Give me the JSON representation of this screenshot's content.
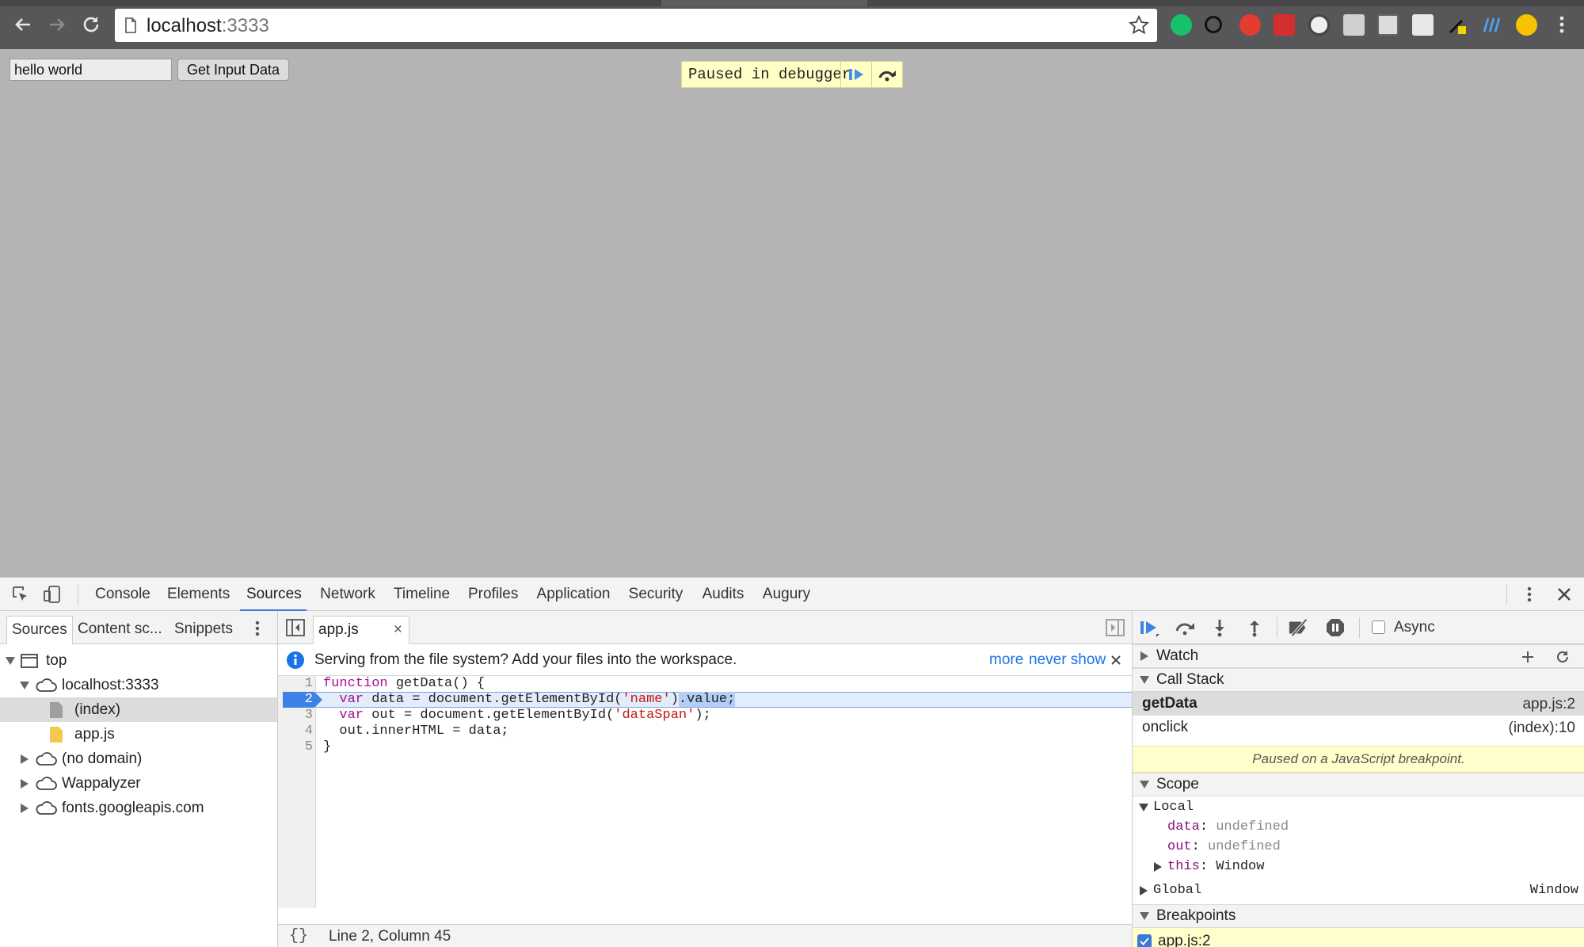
{
  "browser": {
    "url_host": "localhost",
    "url_port": ":3333"
  },
  "page": {
    "input_value": "hello world",
    "button_label": "Get Input Data",
    "paused_text": "Paused in debugger"
  },
  "devtools": {
    "tabs": [
      "Console",
      "Elements",
      "Sources",
      "Network",
      "Timeline",
      "Profiles",
      "Application",
      "Security",
      "Audits",
      "Augury"
    ],
    "active_tab": "Sources",
    "navigator": {
      "tabs": [
        "Sources",
        "Content sc...",
        "Snippets"
      ],
      "tree": [
        {
          "label": "top",
          "type": "frame",
          "expanded": true
        },
        {
          "label": "localhost:3333",
          "type": "domain",
          "expanded": true
        },
        {
          "label": "(index)",
          "type": "file-gray",
          "selected": true
        },
        {
          "label": "app.js",
          "type": "file-yellow"
        },
        {
          "label": "(no domain)",
          "type": "domain",
          "expanded": false
        },
        {
          "label": "Wappalyzer",
          "type": "domain",
          "expanded": false
        },
        {
          "label": "fonts.googleapis.com",
          "type": "domain",
          "expanded": false
        }
      ]
    },
    "editor": {
      "file_tab": "app.js",
      "info_message": "Serving from the file system? Add your files into the workspace.",
      "info_more": "more",
      "info_never_show": "never show",
      "line_numbers": [
        "1",
        "2",
        "3",
        "4",
        "5"
      ],
      "status": "Line 2, Column 45",
      "braces": "{}"
    },
    "sidebar": {
      "async_label": "Async",
      "watch_label": "Watch",
      "call_stack_label": "Call Stack",
      "call_stack": [
        {
          "fn": "getData",
          "loc": "app.js:2"
        },
        {
          "fn": "onclick",
          "loc": "(index):10"
        }
      ],
      "paused_notice": "Paused on a JavaScript breakpoint.",
      "scope_label": "Scope",
      "local_label": "Local",
      "locals": [
        {
          "key": "data",
          "value": "undefined"
        },
        {
          "key": "out",
          "value": "undefined"
        },
        {
          "key": "this",
          "value": "Window"
        }
      ],
      "global_label": "Global",
      "global_value": "Window",
      "breakpoints_label": "Breakpoints",
      "breakpoint_item": "app.js:2"
    }
  },
  "colors": {
    "accent": "#3879d9",
    "page_background": "#b4b4b4",
    "paused_banner": "#ffffc6"
  }
}
